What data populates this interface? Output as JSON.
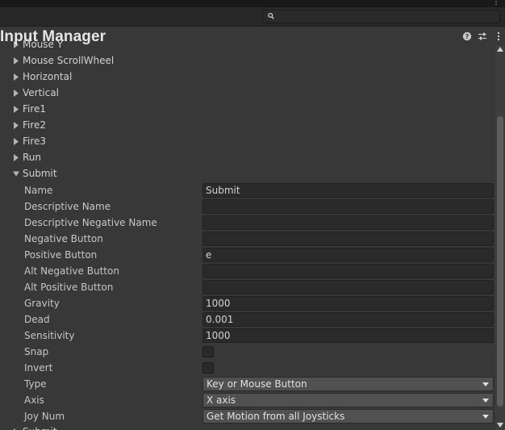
{
  "window": {
    "title": "Input Manager"
  },
  "colors": {
    "background": "#383838",
    "field": "#2a2a2a",
    "dropdown": "#515151",
    "text": "#d2d2d2"
  },
  "icons": {
    "search": "search-icon",
    "help": "help-icon",
    "presets": "presets-sliders-icon",
    "more": "kebab-menu-icon",
    "collapsed": "caret-right-icon",
    "expanded": "caret-down-icon",
    "dropdown": "chevron-down-icon"
  },
  "search": {
    "value": "",
    "placeholder": ""
  },
  "axes_before": [
    "Mouse Y",
    "Mouse ScrollWheel",
    "Horizontal",
    "Vertical",
    "Fire1",
    "Fire2",
    "Fire3",
    "Run"
  ],
  "expanded_axis": {
    "label": "Submit",
    "properties": [
      {
        "label": "Name",
        "kind": "text",
        "value": "Submit"
      },
      {
        "label": "Descriptive Name",
        "kind": "text",
        "value": ""
      },
      {
        "label": "Descriptive Negative Name",
        "kind": "text",
        "value": ""
      },
      {
        "label": "Negative Button",
        "kind": "text",
        "value": ""
      },
      {
        "label": "Positive Button",
        "kind": "text",
        "value": "e"
      },
      {
        "label": "Alt Negative Button",
        "kind": "text",
        "value": ""
      },
      {
        "label": "Alt Positive Button",
        "kind": "text",
        "value": ""
      },
      {
        "label": "Gravity",
        "kind": "text",
        "value": "1000"
      },
      {
        "label": "Dead",
        "kind": "text",
        "value": "0.001"
      },
      {
        "label": "Sensitivity",
        "kind": "text",
        "value": "1000"
      },
      {
        "label": "Snap",
        "kind": "toggle",
        "checked": false
      },
      {
        "label": "Invert",
        "kind": "toggle",
        "checked": false
      },
      {
        "label": "Type",
        "kind": "dropdown",
        "value": "Key or Mouse Button"
      },
      {
        "label": "Axis",
        "kind": "dropdown",
        "value": "X axis"
      },
      {
        "label": "Joy Num",
        "kind": "dropdown",
        "value": "Get Motion from all Joysticks"
      }
    ]
  },
  "axes_after": [
    "Submit"
  ]
}
